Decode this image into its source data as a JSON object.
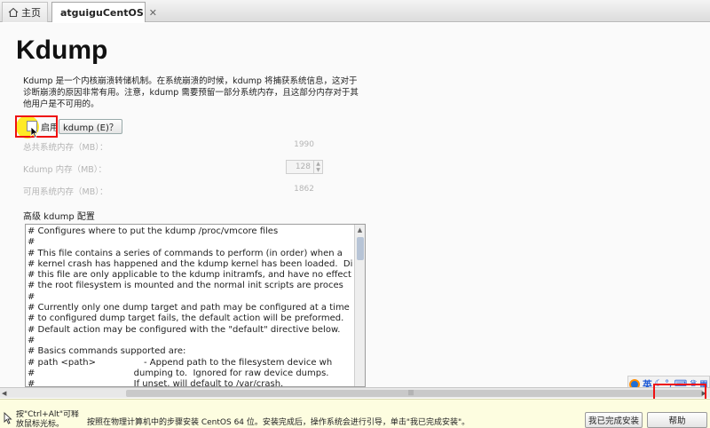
{
  "tabs": {
    "home_label": "主页",
    "active_label": "atguiguCentOS",
    "close": "✕"
  },
  "page": {
    "title": "Kdump",
    "description": "Kdump 是一个内核崩溃转储机制。在系统崩溃的时候，kdump 将捕获系统信息，这对于诊断崩溃的原因非常有用。注意，kdump 需要预留一部分系统内存，且这部分内存对于其他用户是不可用的。",
    "enable_label": "启用",
    "kdump_button": "kdump (E)？",
    "enable_checked": false
  },
  "memory": {
    "total_label": "总共系统内存（MB）：",
    "total_value": "1990",
    "kdump_label": "Kdump 内存（MB）：",
    "kdump_value": "128",
    "usable_label": "可用系统内存（MB）：",
    "usable_value": "1862"
  },
  "advanced": {
    "label": "高级 kdump 配置",
    "lines": [
      "# Configures where to put the kdump /proc/vmcore files",
      "#",
      "# This file contains a series of commands to perform (in order) when a",
      "# kernel crash has happened and the kdump kernel has been loaded.  Di",
      "# this file are only applicable to the kdump initramfs, and have no effect",
      "# the root filesystem is mounted and the normal init scripts are proces",
      "#",
      "# Currently only one dump target and path may be configured at a time",
      "# to configured dump target fails, the default action will be preformed.",
      "# Default action may be configured with the \"default\" directive below.",
      "#",
      "# Basics commands supported are:",
      "# path <path>                 - Append path to the filesystem device wh",
      "#                                   dumping to.  Ignored for raw device dumps.",
      "#                                   If unset, will default to /var/crash."
    ]
  },
  "ime": {
    "lang": "英",
    "icons": [
      "moon-icon",
      "comma-icon",
      "keyboard-icon",
      "shirt-icon",
      "grid-icon"
    ]
  },
  "hintbar": {
    "left_hint": "按\"Ctrl+Alt\"可释放鼠标光标。",
    "main_hint": "按照在物理计算机中的步骤安装 CentOS 64 位。安装完成后，操作系统会进行引导，单击\"我已完成安装\"。",
    "done_button": "我已完成安装",
    "help_button": "帮助"
  },
  "colors": {
    "highlight_red": "#ee1111",
    "cursor_yellow": "#ffe600",
    "hint_bg": "#fdfde0"
  }
}
